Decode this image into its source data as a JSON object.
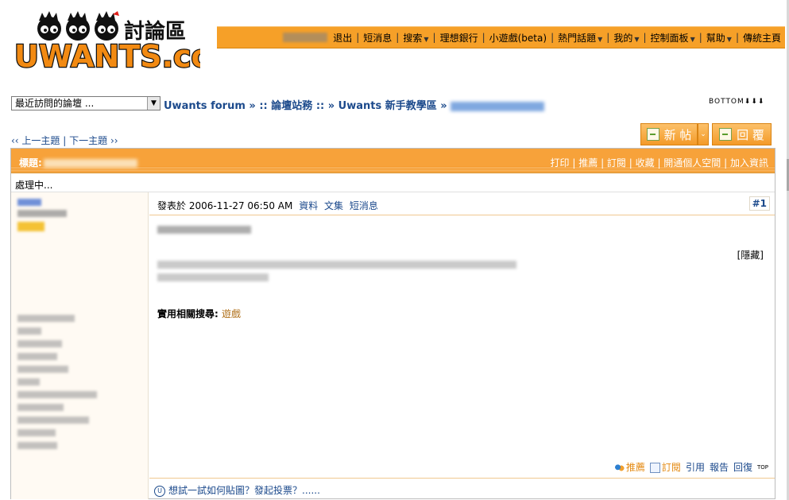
{
  "logo": {
    "text": "UWANTS.com",
    "subtitle": "討論區"
  },
  "topnav": {
    "items": [
      {
        "label": "退出"
      },
      {
        "label": "短消息"
      },
      {
        "label": "搜索",
        "dropdown": true
      },
      {
        "label": "理想銀行"
      },
      {
        "label": "小遊戲(beta)"
      },
      {
        "label": "熱門話題",
        "dropdown": true
      },
      {
        "label": "我的",
        "dropdown": true
      },
      {
        "label": "控制面板",
        "dropdown": true
      },
      {
        "label": "幫助",
        "dropdown": true
      },
      {
        "label": "傳統主頁"
      }
    ]
  },
  "forum_select": {
    "value": "最近訪問的論壇 ..."
  },
  "breadcrumb": {
    "root": "Uwants forum",
    "sep1": "» ::",
    "section": "論壇站務",
    "sep2": ":: »",
    "forum": "Uwants 新手教學區",
    "sep3": "»"
  },
  "bottom_link": "BOTTOM",
  "prevnext": {
    "prev": "‹‹ 上一主題",
    "divider": "|",
    "next": "下一主題 ››"
  },
  "buttons": {
    "new": "新 帖",
    "reply": "回 覆"
  },
  "post": {
    "title_label": "標題:",
    "tools": [
      "打印",
      "推薦",
      "訂閱",
      "收藏",
      "開通個人空間",
      "加入資訊"
    ],
    "processing": "處理中...",
    "meta_prefix": "發表於",
    "meta_datetime": "2006-11-27 06:50 AM",
    "meta_links": [
      "資料",
      "文集",
      "短消息"
    ],
    "number": "#1",
    "hide_tag": "[隱藏]",
    "related_label": "實用相關搜尋:",
    "related_link": "遊戲",
    "actions": [
      "推薦",
      "訂閱",
      "引用",
      "報告",
      "回復"
    ],
    "top_label": "TOP",
    "footer_tip": "想試一試如何貼圖？發起投票？......"
  },
  "colors": {
    "accent": "#f6a028",
    "link": "#1c4a8c"
  }
}
